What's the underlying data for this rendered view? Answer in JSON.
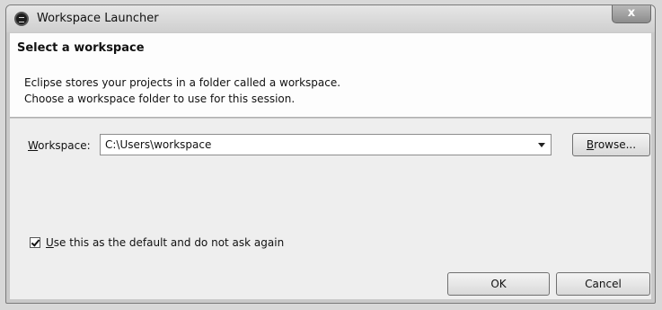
{
  "window": {
    "title": "Workspace Launcher",
    "close_label": "x"
  },
  "header": {
    "title": "Select a workspace",
    "desc_line1": "Eclipse stores your projects in a folder called a workspace.",
    "desc_line2": "Choose a workspace folder to use for this session."
  },
  "workspace": {
    "label_mnemonic": "W",
    "label_rest": "orkspace:",
    "value": "C:\\Users\\workspace",
    "browse_mnemonic": "B",
    "browse_rest": "rowse..."
  },
  "default_checkbox": {
    "checked": true,
    "mnemonic": "U",
    "rest": "se this as the default and do not ask again"
  },
  "buttons": {
    "ok": "OK",
    "cancel": "Cancel"
  },
  "icons": {
    "app": "eclipse-icon",
    "dropdown": "chevron-down-icon",
    "close": "close-icon",
    "check": "checkmark-icon"
  }
}
